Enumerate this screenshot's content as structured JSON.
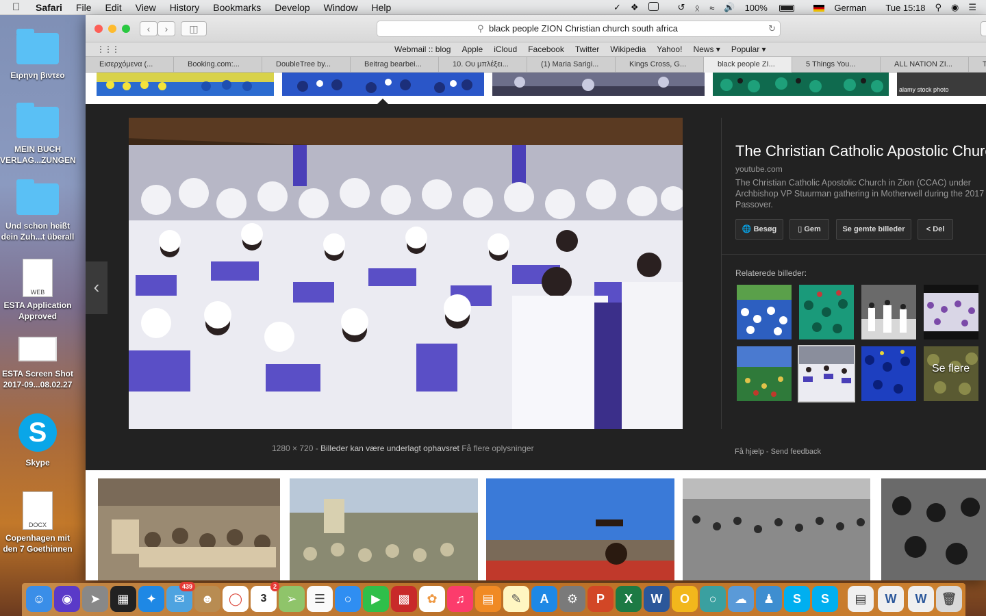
{
  "menubar": {
    "app": "Safari",
    "items": [
      "File",
      "Edit",
      "View",
      "History",
      "Bookmarks",
      "Develop",
      "Window",
      "Help"
    ],
    "battery": "100%",
    "input_source": "German",
    "clock": "Tue 15:18"
  },
  "desktop": {
    "icons": [
      {
        "label_1": "Ειρηνη βιντεο",
        "label_2": ""
      },
      {
        "label_1": "MEIN BUCH",
        "label_2": "VERLAG...ZUNGEN"
      },
      {
        "label_1": "Und schon heißt",
        "label_2": "dein Zuh...t überall"
      },
      {
        "label_1": "ESTA Application",
        "label_2": "Approved",
        "doc_tag": "WEB"
      },
      {
        "label_1": "ESTA Screen Shot",
        "label_2": "2017-09...08.02.27"
      },
      {
        "label_1": "Skype",
        "label_2": ""
      },
      {
        "label_1": "Copenhagen mit",
        "label_2": "den 7 Goethinnen",
        "doc_tag": "DOCX"
      }
    ]
  },
  "browser": {
    "address": "black people  ZION Christian church south africa",
    "favorites": [
      "Webmail :: blog",
      "Apple",
      "iCloud",
      "Facebook",
      "Twitter",
      "Wikipedia",
      "Yahoo!",
      "News ▾",
      "Popular ▾"
    ],
    "tabs": [
      "Εισερχόμενα (...",
      "Booking.com:...",
      "DoubleTree by...",
      "Beitrag bearbei...",
      "10. Ου μπλέξει...",
      "(1) Maria Sarigi...",
      "Kings Cross, G...",
      "black people ZI...",
      "5 Things You...",
      "ALL NATION ZI...",
      "T"
    ]
  },
  "strip": {
    "alamy": "alamy stock photo"
  },
  "viewer": {
    "image_size": "1280 × 720",
    "rights": "Billeder kan være underlagt ophavsret",
    "more_info": "Få flere oplysninger",
    "title": "The Christian Catholic Apostolic Church",
    "source": "youtube.com",
    "description": "The Christian Catholic Apostolic Church in Zion (CCAC) under Archbishop VP Stuurman gathering in Motherwell during the 2017 Passover.",
    "buttons": {
      "visit": "Besøg",
      "save": "Gem",
      "saved": "Se gemte billeder",
      "share": "Del"
    },
    "related_label": "Relaterede billeder:",
    "see_more": "Se flere",
    "help": "Få hjælp",
    "feedback": "Send feedback"
  },
  "dock": {
    "mail_badge": "439",
    "calendar_badge": "2",
    "calendar_day": "3"
  },
  "colors": {
    "viewer_bg": "#222222",
    "robe_blue": "#4a3fb8",
    "robe_white": "#f2f2f6"
  }
}
